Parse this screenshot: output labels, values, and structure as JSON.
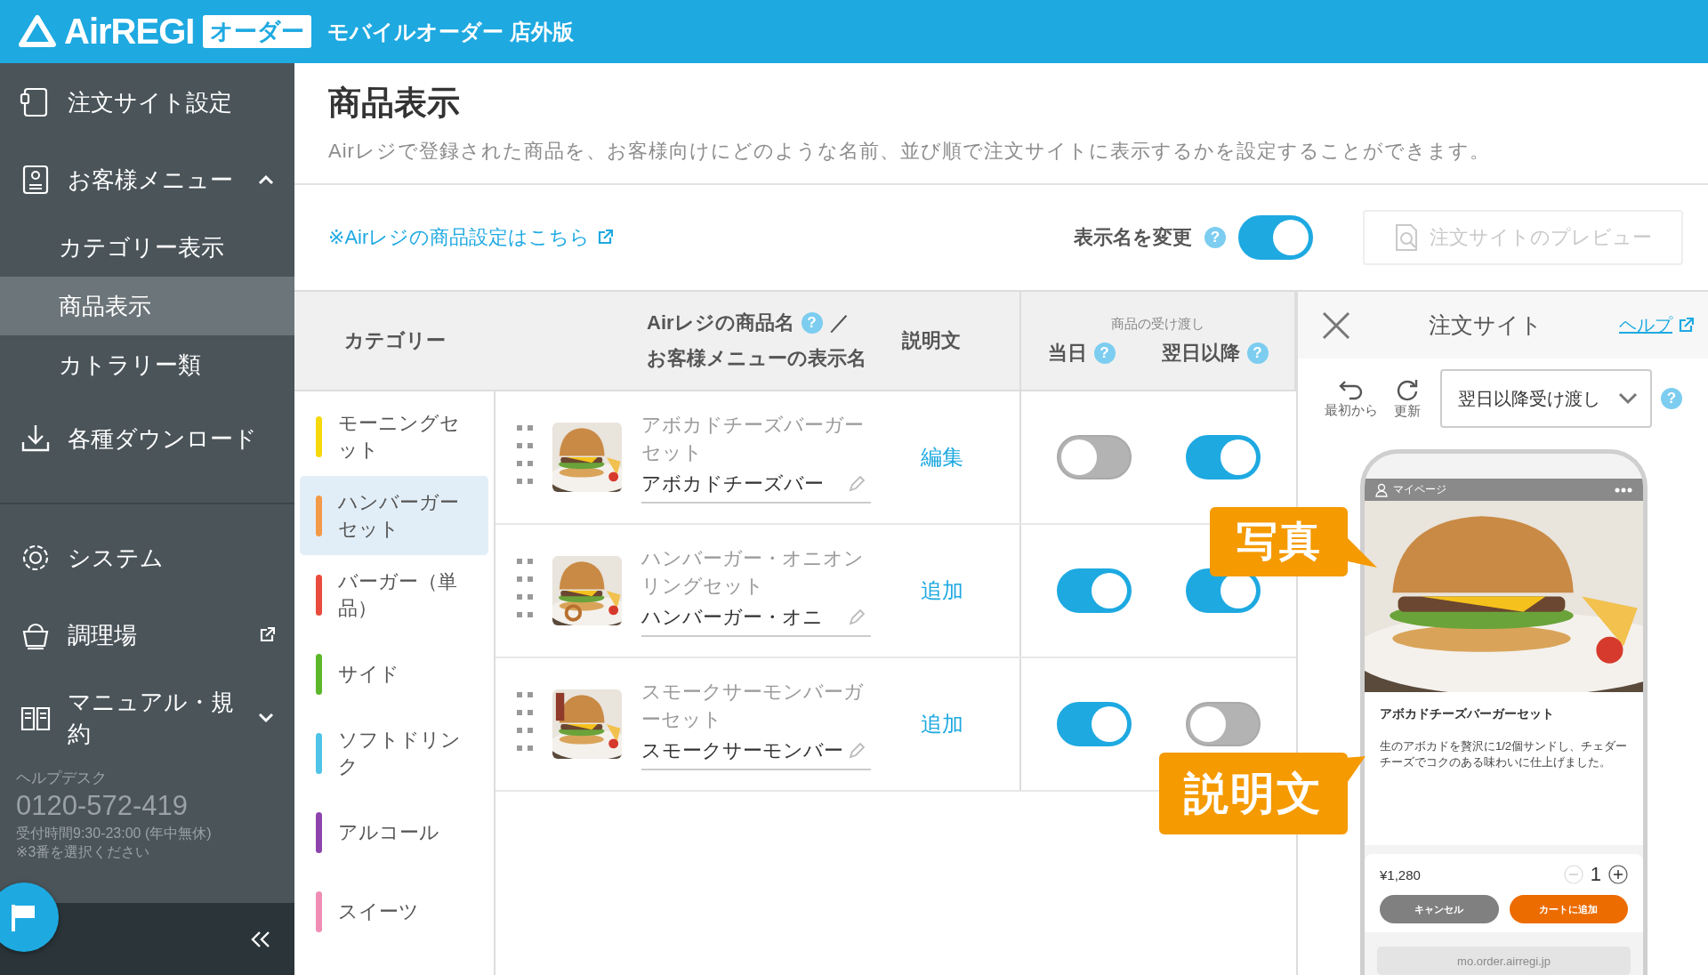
{
  "header": {
    "brand": "AirREGI",
    "badge": "オーダー",
    "title": "モバイルオーダー 店外版"
  },
  "sidebar": {
    "groups": [
      {
        "items": [
          {
            "label": "注文サイト設定"
          },
          {
            "label": "お客様メニュー",
            "expanded": true,
            "children": [
              {
                "label": "カテゴリー表示",
                "selected": false
              },
              {
                "label": "商品表示",
                "selected": true
              },
              {
                "label": "カトラリー類",
                "selected": false
              }
            ]
          },
          {
            "label": "各種ダウンロード"
          }
        ]
      },
      {
        "items": [
          {
            "label": "システム"
          },
          {
            "label": "調理場",
            "external": true
          },
          {
            "label": "マニュアル・規約",
            "expanded": false
          }
        ]
      }
    ],
    "helpdesk": {
      "label": "ヘルプデスク",
      "phone": "0120-572-419",
      "hours": "受付時間9:30-23:00 (年中無休)",
      "note": "※3番を選択ください"
    }
  },
  "page": {
    "title": "商品表示",
    "description": "Airレジで登録された商品を、お客様向けにどのような名前、並び順で注文サイトに表示するかを設定することができます。",
    "settings_link": "※Airレジの商品設定はこちら",
    "rename_label": "表示名を変更",
    "rename_help": "?",
    "rename_on": true,
    "preview_button": {
      "label": "注文サイトのプレビュー",
      "disabled": true
    }
  },
  "table": {
    "headers": {
      "category": "カテゴリー",
      "name_line1": "Airレジの商品名",
      "name_help": "?",
      "slash": "／",
      "name_line2": "お客様メニューの表示名",
      "description": "説明文",
      "delivery_group": "商品の受け渡し",
      "same_day": "当日",
      "same_day_help": "?",
      "next_day": "翌日以降",
      "next_day_help": "?"
    },
    "categories": [
      {
        "name": "モーニングセット",
        "color": "#f5d90a",
        "selected": false
      },
      {
        "name": "ハンバーガーセット",
        "color": "#f39a48",
        "selected": true
      },
      {
        "name": "バーガー（単品）",
        "color": "#e94b3c",
        "selected": false
      },
      {
        "name": "サイド",
        "color": "#5cb82a",
        "selected": false
      },
      {
        "name": "ソフトドリンク",
        "color": "#4fc3e8",
        "selected": false
      },
      {
        "name": "アルコール",
        "color": "#8e44ad",
        "selected": false
      },
      {
        "name": "スイーツ",
        "color": "#f08db5",
        "selected": false
      }
    ],
    "products": [
      {
        "name": "アボカドチーズバーガーセット",
        "display_name": "アボカドチーズバー",
        "description_action": "編集",
        "same_day": false,
        "next_day": true
      },
      {
        "name": "ハンバーガー・オニオンリングセット",
        "display_name": "ハンバーガー・オニ",
        "description_action": "追加",
        "same_day": true,
        "next_day": true
      },
      {
        "name": "スモークサーモンバーガーセット",
        "display_name": "スモークサーモンバー",
        "description_action": "追加",
        "same_day": true,
        "next_day": false
      }
    ]
  },
  "preview": {
    "title": "注文サイト",
    "help": "ヘルプ",
    "restart": "最初から",
    "refresh": "更新",
    "mode": "翌日以降受け渡し",
    "mode_help": "?",
    "phone": {
      "account": "マイページ",
      "product_name": "アボカドチーズバーガーセット",
      "product_description": "生のアボカドを贅沢に1/2個サンドし、チェダーチーズでコクのある味わいに仕上げました。",
      "price": "¥1,280",
      "quantity": "1",
      "cancel": "キャンセル",
      "add_to_cart": "カートに追加",
      "url": "mo.order.airregi.jp"
    }
  },
  "callouts": [
    {
      "label": "写真"
    },
    {
      "label": "説明文"
    }
  ]
}
